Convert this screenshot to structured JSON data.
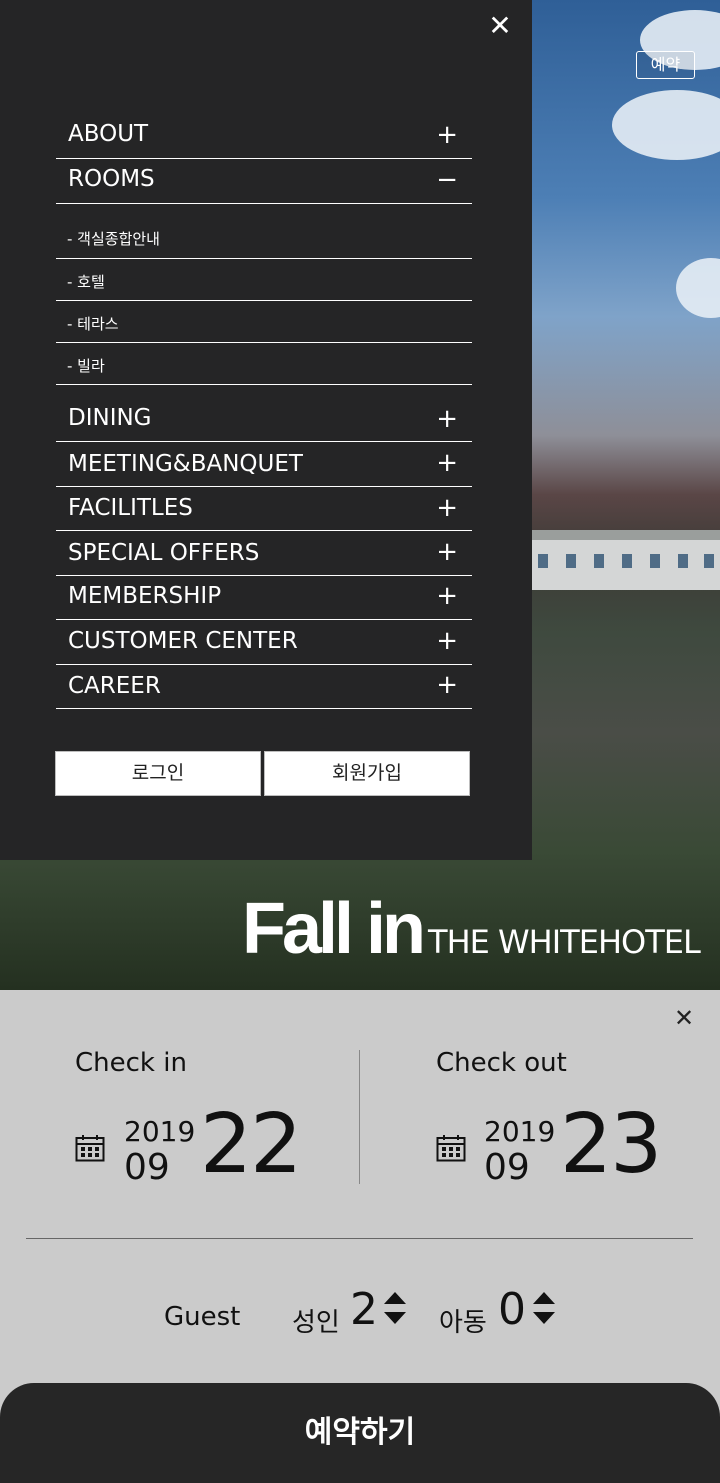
{
  "hero": {
    "reserve_label": "예약",
    "tagline_big": "Fall in",
    "tagline_small": "THE WHITEHOTEL"
  },
  "menu": {
    "close_icon": "close-icon",
    "items": [
      {
        "label": "ABOUT",
        "sign": "+"
      },
      {
        "label": "ROOMS",
        "sign": "−"
      },
      {
        "label": "DINING",
        "sign": "+"
      },
      {
        "label": "MEETING&BANQUET",
        "sign": "+"
      },
      {
        "label": "FACILITLES",
        "sign": "+"
      },
      {
        "label": "SPECIAL OFFERS",
        "sign": "+"
      },
      {
        "label": "MEMBERSHIP",
        "sign": "+"
      },
      {
        "label": "CUSTOMER CENTER",
        "sign": "+"
      },
      {
        "label": "CAREER",
        "sign": "+"
      }
    ],
    "rooms_sub": [
      "- 객실종합안내",
      "- 호텔",
      "- 테라스",
      "- 빌라"
    ],
    "login_label": "로그인",
    "signup_label": "회원가입"
  },
  "booking": {
    "checkin_label": "Check in",
    "checkout_label": "Check out",
    "checkin": {
      "year": "2019",
      "month": "09",
      "day": "22"
    },
    "checkout": {
      "year": "2019",
      "month": "09",
      "day": "23"
    },
    "guest_label": "Guest",
    "adult_label": "성인",
    "adult_count": "2",
    "child_label": "아동",
    "child_count": "0",
    "book_button": "예약하기"
  }
}
